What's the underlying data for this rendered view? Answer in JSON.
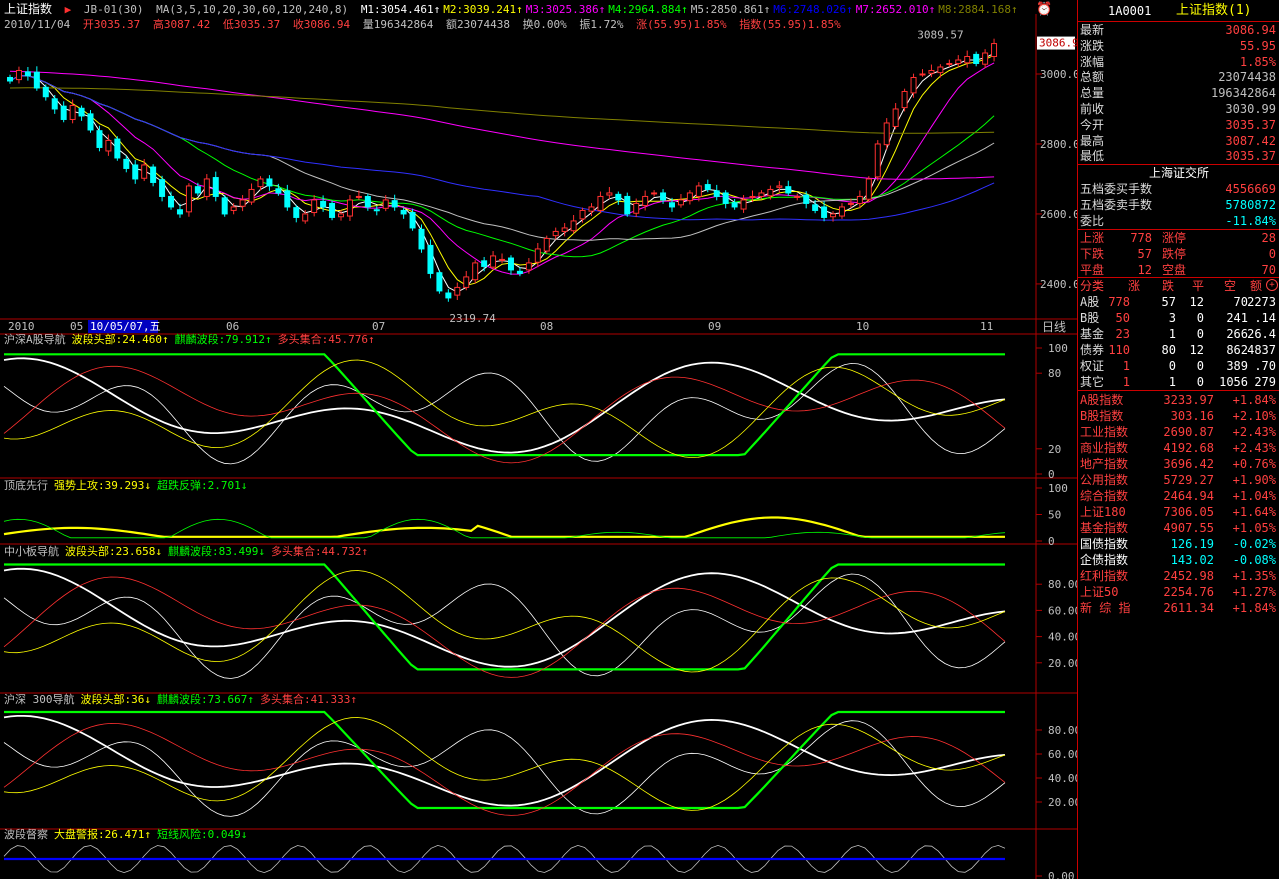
{
  "title_bar": {
    "index_name": "上证指数",
    "formula": "JB-01(30)",
    "ma_label": "MA(3,5,10,20,30,60,120,240,8)",
    "ma": [
      {
        "name": "M1",
        "value": "3054.461",
        "color": "#ffffff"
      },
      {
        "name": "M2",
        "value": "3039.241",
        "color": "#ffff00"
      },
      {
        "name": "M3",
        "value": "3025.386",
        "color": "#ff00ff"
      },
      {
        "name": "M4",
        "value": "2964.884",
        "color": "#00ff00"
      },
      {
        "name": "M5",
        "value": "2850.861",
        "color": "#c0c0c0"
      },
      {
        "name": "M6",
        "value": "2748.026",
        "color": "#0000ff"
      },
      {
        "name": "M7",
        "value": "2652.010",
        "color": "#ff00ff"
      },
      {
        "name": "M8",
        "value": "2884.168",
        "color": "#808000"
      }
    ]
  },
  "quote_line": {
    "date": "2010/11/04",
    "open": "开3035.37",
    "high": "高3087.42",
    "low": "低3035.37",
    "close": "收3086.94",
    "volume": "量196342864",
    "amount": "额23074438",
    "turnover": "换0.00%",
    "amplitude": "振1.72%",
    "change": "涨(55.95)1.85%",
    "index": "指数(55.95)1.85%"
  },
  "chart_data": [
    {
      "type": "candlestick",
      "title": "上证指数 日线",
      "ylim": [
        2319.74,
        3100
      ],
      "yticks": [
        "3000.0",
        "2800.0",
        "2600.0",
        "2400.0"
      ],
      "ytick_values": [
        3000,
        2800,
        2600,
        2400
      ],
      "annotations": [
        {
          "label": "3089.57",
          "value": 3089.57
        },
        {
          "label": "2319.74",
          "value": 2319.74
        }
      ],
      "last_price_tag": "3086.94",
      "x_labels": [
        "2010",
        "05",
        "06",
        "07",
        "08",
        "09",
        "10",
        "11"
      ],
      "cursor_date": "10/05/07,五",
      "period": "日线",
      "closes": [
        2980,
        3010,
        2995,
        2960,
        2935,
        2900,
        2870,
        2910,
        2880,
        2840,
        2790,
        2810,
        2760,
        2730,
        2700,
        2740,
        2690,
        2650,
        2620,
        2600,
        2680,
        2660,
        2700,
        2650,
        2600,
        2620,
        2640,
        2670,
        2700,
        2680,
        2660,
        2620,
        2590,
        2600,
        2640,
        2620,
        2590,
        2600,
        2640,
        2650,
        2620,
        2610,
        2640,
        2620,
        2600,
        2560,
        2500,
        2430,
        2380,
        2360,
        2390,
        2420,
        2460,
        2450,
        2480,
        2470,
        2440,
        2430,
        2460,
        2500,
        2530,
        2550,
        2560,
        2580,
        2610,
        2620,
        2650,
        2660,
        2640,
        2600,
        2630,
        2650,
        2660,
        2640,
        2620,
        2640,
        2660,
        2680,
        2670,
        2650,
        2630,
        2620,
        2640,
        2650,
        2660,
        2670,
        2680,
        2660,
        2650,
        2630,
        2610,
        2590,
        2600,
        2620,
        2630,
        2650,
        2700,
        2800,
        2860,
        2900,
        2950,
        2990,
        3000,
        3010,
        3020,
        3030,
        3040,
        3050,
        3030,
        3060,
        3086.94
      ]
    },
    {
      "type": "line",
      "title": "沪深A股导航",
      "series": [
        {
          "name": "波段头部",
          "value": "24.460",
          "arrow": "↑",
          "color": "#ffff00"
        },
        {
          "name": "麒麟波段",
          "value": "79.912",
          "arrow": "↑",
          "color": "#00ff00"
        },
        {
          "name": "多头集合",
          "value": "45.776",
          "arrow": "↑",
          "color": "#ff4040"
        }
      ],
      "yticks": [
        "100",
        "80",
        "20",
        "0"
      ],
      "ytick_values": [
        100,
        80,
        20,
        0
      ]
    },
    {
      "type": "line",
      "title": "顶底先行",
      "series": [
        {
          "name": "强势上攻",
          "value": "39.293",
          "arrow": "↓",
          "color": "#ffff00"
        },
        {
          "name": "超跌反弹",
          "value": "2.701",
          "arrow": "↓",
          "color": "#00ff00"
        }
      ],
      "yticks": [
        "100",
        "50",
        "0"
      ],
      "ytick_values": [
        100,
        50,
        0
      ]
    },
    {
      "type": "line",
      "title": "中小板导航",
      "series": [
        {
          "name": "波段头部",
          "value": "23.658",
          "arrow": "↓",
          "color": "#ffff00"
        },
        {
          "name": "麒麟波段",
          "value": "83.499",
          "arrow": "↓",
          "color": "#00ff00"
        },
        {
          "name": "多头集合",
          "value": "44.732",
          "arrow": "↑",
          "color": "#ff4040"
        }
      ],
      "yticks": [
        "80.00",
        "60.00",
        "40.00",
        "20.00"
      ],
      "ytick_values": [
        80,
        60,
        40,
        20
      ]
    },
    {
      "type": "line",
      "title": "沪深 300导航",
      "series": [
        {
          "name": "波段头部",
          "value": "36",
          "arrow": "↓",
          "color": "#ffff00"
        },
        {
          "name": "麒麟波段",
          "value": "73.667",
          "arrow": "↑",
          "color": "#00ff00"
        },
        {
          "name": "多头集合",
          "value": "41.333",
          "arrow": "↑",
          "color": "#ff4040"
        }
      ],
      "yticks": [
        "80.00",
        "60.00",
        "40.00",
        "20.00"
      ],
      "ytick_values": [
        80,
        60,
        40,
        20
      ]
    },
    {
      "type": "line",
      "title": "波段督察",
      "series": [
        {
          "name": "大盘警报",
          "value": "26.471",
          "arrow": "↑",
          "color": "#ffff00"
        },
        {
          "name": "短线风险",
          "value": "0.049",
          "arrow": "↓",
          "color": "#00ff00"
        }
      ],
      "yticks": [
        "0.00"
      ],
      "ytick_values": [
        0
      ]
    }
  ],
  "panel": {
    "code": "1A0001",
    "name": "上证指数(1)",
    "quote": [
      {
        "k": "最新",
        "v": "3086.94",
        "c": "#ff4040"
      },
      {
        "k": "涨跌",
        "v": "55.95",
        "c": "#ff4040"
      },
      {
        "k": "涨幅",
        "v": "1.85%",
        "c": "#ff4040"
      },
      {
        "k": "总额",
        "v": "23074438",
        "c": "#c0c0c0"
      },
      {
        "k": "总量",
        "v": "196342864",
        "c": "#c0c0c0"
      },
      {
        "k": "前收",
        "v": "3030.99",
        "c": "#c0c0c0"
      },
      {
        "k": "今开",
        "v": "3035.37",
        "c": "#ff4040"
      },
      {
        "k": "最高",
        "v": "3087.42",
        "c": "#ff4040"
      },
      {
        "k": "最低",
        "v": "3035.37",
        "c": "#ff4040"
      }
    ],
    "exchange": "上海证交所",
    "orders": [
      {
        "k": "五档委买手数",
        "v": "4556669",
        "c": "#ff4040"
      },
      {
        "k": "五档委卖手数",
        "v": "5780872",
        "c": "#00ffff"
      },
      {
        "k": "委比",
        "v": "-11.84%",
        "c": "#00ffff"
      }
    ],
    "breadth": [
      {
        "k1": "上涨",
        "v1": "778",
        "k2": "涨停",
        "v2": "28"
      },
      {
        "k1": "下跌",
        "v1": "57",
        "k2": "跌停",
        "v2": "0"
      },
      {
        "k1": "平盘",
        "v1": "12",
        "k2": "空盘",
        "v2": "70"
      }
    ],
    "cat_header": [
      "分类",
      "涨",
      "跌",
      "平",
      "空",
      "额"
    ],
    "categories": [
      {
        "n": "A股",
        "u": "778",
        "d": "57",
        "f": "12",
        "e": "70",
        "a": "2273"
      },
      {
        "n": "B股",
        "u": "50",
        "d": "3",
        "f": "0",
        "e": "241",
        "a": ".14"
      },
      {
        "n": "基金",
        "u": "23",
        "d": "1",
        "f": "0",
        "e": "266",
        "a": "26.4"
      },
      {
        "n": "债券",
        "u": "110",
        "d": "80",
        "f": "12",
        "e": "862",
        "a": "4837"
      },
      {
        "n": "权证",
        "u": "1",
        "d": "0",
        "f": "0",
        "e": "389",
        "a": ".70"
      },
      {
        "n": "其它",
        "u": "1",
        "d": "1",
        "f": "0",
        "e": "1056",
        "a": "279"
      }
    ],
    "indices": [
      {
        "n": "A股指数",
        "p": "3233.97",
        "c": "+1.84%"
      },
      {
        "n": "B股指数",
        "p": "303.16",
        "c": "+2.10%"
      },
      {
        "n": "工业指数",
        "p": "2690.87",
        "c": "+2.43%"
      },
      {
        "n": "商业指数",
        "p": "4192.68",
        "c": "+2.43%"
      },
      {
        "n": "地产指数",
        "p": "3696.42",
        "c": "+0.76%"
      },
      {
        "n": "公用指数",
        "p": "5729.27",
        "c": "+1.90%"
      },
      {
        "n": "综合指数",
        "p": "2464.94",
        "c": "+1.04%"
      },
      {
        "n": "上证180",
        "p": "7306.05",
        "c": "+1.64%"
      },
      {
        "n": "基金指数",
        "p": "4907.55",
        "c": "+1.05%"
      },
      {
        "n": "国债指数",
        "p": "126.19",
        "c": "-0.02%"
      },
      {
        "n": "企债指数",
        "p": "143.02",
        "c": "-0.08%"
      },
      {
        "n": "红利指数",
        "p": "2452.98",
        "c": "+1.35%"
      },
      {
        "n": "上证50",
        "p": "2254.76",
        "c": "+1.27%"
      },
      {
        "n": "新 综 指",
        "p": "2611.34",
        "c": "+1.84%"
      }
    ]
  }
}
